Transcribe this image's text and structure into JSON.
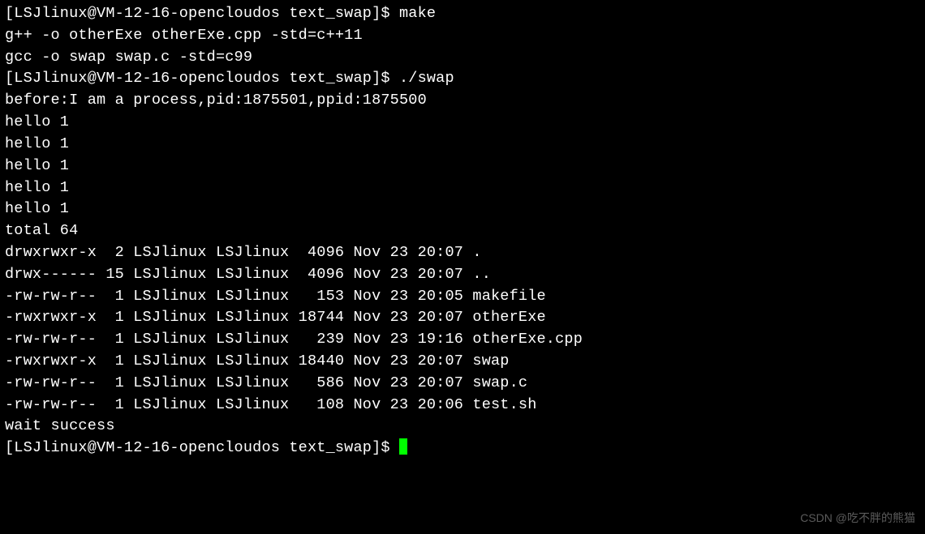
{
  "prompt": {
    "user": "LSJlinux",
    "host": "VM-12-16-opencloudos",
    "cwd": "text_swap",
    "symbol": "$"
  },
  "commands": {
    "make": "make",
    "run": "./swap"
  },
  "build_output": [
    "g++ -o otherExe otherExe.cpp -std=c++11",
    "gcc -o swap swap.c -std=c99"
  ],
  "run_output": {
    "before": "before:I am a process,pid:1875501,ppid:1875500",
    "hello_lines": [
      "hello 1",
      "hello 1",
      "hello 1",
      "hello 1",
      "hello 1"
    ],
    "ls_total": "total 64",
    "ls_entries": [
      {
        "perm": "drwxrwxr-x",
        "links": " 2",
        "owner": "LSJlinux",
        "group": "LSJlinux",
        "size": " 4096",
        "date": "Nov 23 20:07",
        "name": "."
      },
      {
        "perm": "drwx------",
        "links": "15",
        "owner": "LSJlinux",
        "group": "LSJlinux",
        "size": " 4096",
        "date": "Nov 23 20:07",
        "name": ".."
      },
      {
        "perm": "-rw-rw-r--",
        "links": " 1",
        "owner": "LSJlinux",
        "group": "LSJlinux",
        "size": "  153",
        "date": "Nov 23 20:05",
        "name": "makefile"
      },
      {
        "perm": "-rwxrwxr-x",
        "links": " 1",
        "owner": "LSJlinux",
        "group": "LSJlinux",
        "size": "18744",
        "date": "Nov 23 20:07",
        "name": "otherExe"
      },
      {
        "perm": "-rw-rw-r--",
        "links": " 1",
        "owner": "LSJlinux",
        "group": "LSJlinux",
        "size": "  239",
        "date": "Nov 23 19:16",
        "name": "otherExe.cpp"
      },
      {
        "perm": "-rwxrwxr-x",
        "links": " 1",
        "owner": "LSJlinux",
        "group": "LSJlinux",
        "size": "18440",
        "date": "Nov 23 20:07",
        "name": "swap"
      },
      {
        "perm": "-rw-rw-r--",
        "links": " 1",
        "owner": "LSJlinux",
        "group": "LSJlinux",
        "size": "  586",
        "date": "Nov 23 20:07",
        "name": "swap.c"
      },
      {
        "perm": "-rw-rw-r--",
        "links": " 1",
        "owner": "LSJlinux",
        "group": "LSJlinux",
        "size": "  108",
        "date": "Nov 23 20:06",
        "name": "test.sh"
      }
    ],
    "wait": "wait success"
  },
  "watermark": "CSDN @吃不胖的熊猫"
}
